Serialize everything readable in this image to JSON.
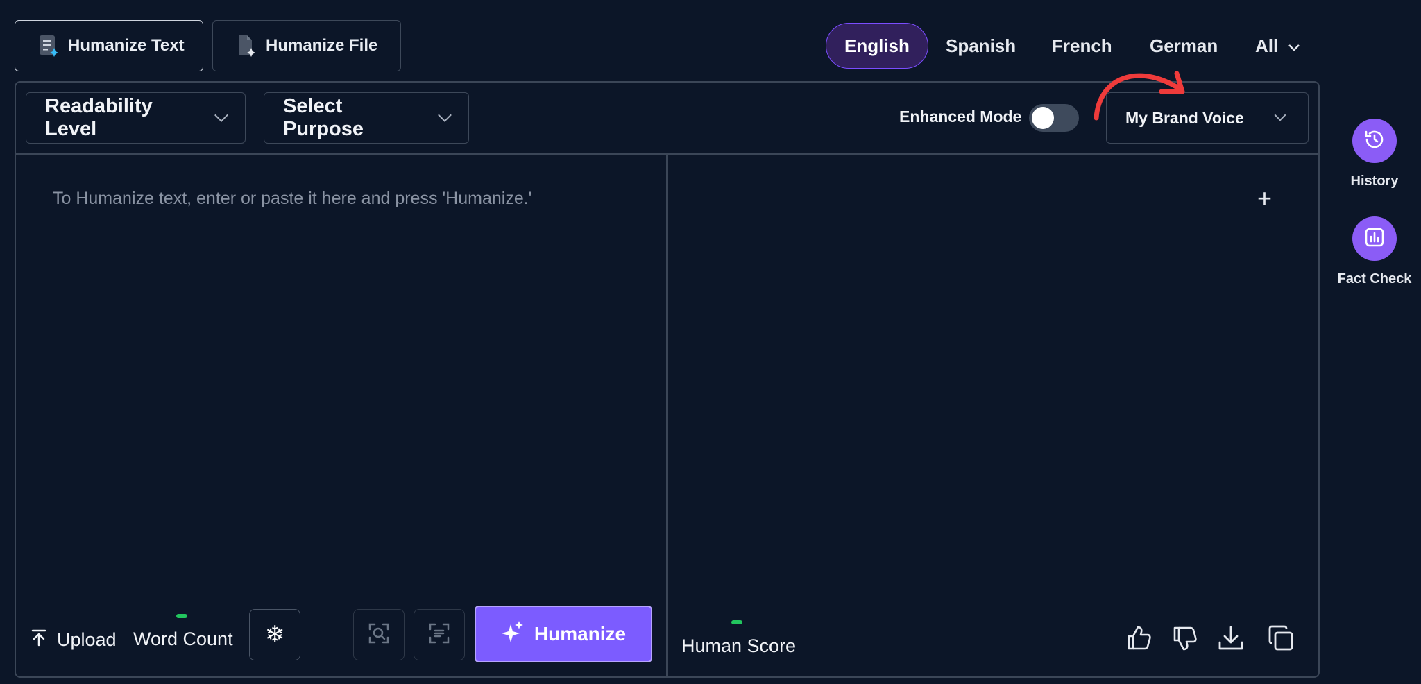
{
  "mode_tabs": [
    {
      "label": "Humanize Text",
      "icon": "document-sparkle-icon",
      "active": true
    },
    {
      "label": "Humanize File",
      "icon": "file-sparkle-icon",
      "active": false
    }
  ],
  "languages": [
    {
      "label": "English",
      "active": true
    },
    {
      "label": "Spanish"
    },
    {
      "label": "French"
    },
    {
      "label": "German"
    },
    {
      "label": "All",
      "icon": "chevron-down-icon"
    }
  ],
  "toolbar": {
    "readability_label": "Readability Level",
    "purpose_label": "Select Purpose",
    "enhanced_mode_label": "Enhanced Mode",
    "enhanced_mode_on": false,
    "brand_voice_label": "My Brand Voice"
  },
  "editor": {
    "input_placeholder": "To Humanize text, enter or paste it here and press 'Humanize.'",
    "upload_label": "Upload",
    "word_count_label": "Word Count",
    "humanize_label": "Humanize"
  },
  "output": {
    "human_score_label": "Human Score"
  },
  "side": {
    "history_label": "History",
    "fact_check_label": "Fact Check"
  },
  "colors": {
    "background": "#0c1628",
    "accent": "#7c5cff",
    "side_button": "#8b5cf6",
    "indicator": "#22c55e",
    "annotation_arrow": "#ef3b3b"
  }
}
